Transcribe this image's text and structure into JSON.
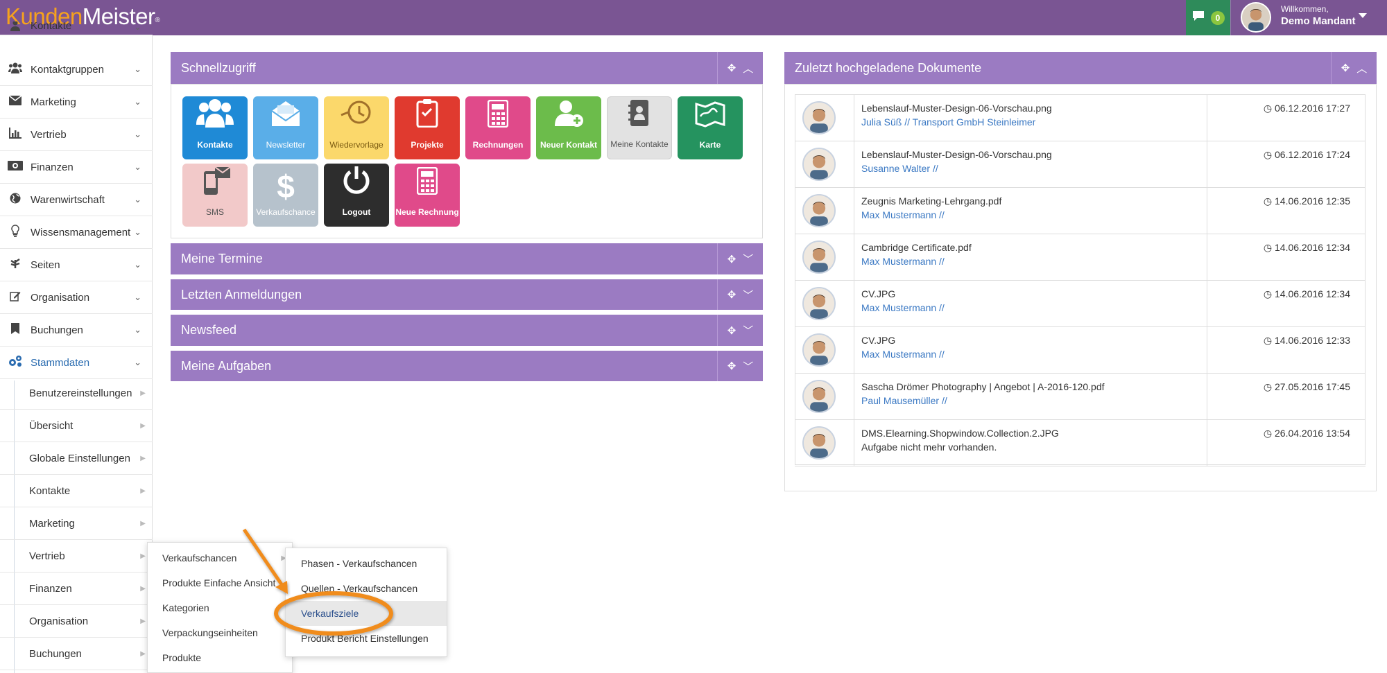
{
  "header": {
    "logo_part1": "Kunden",
    "logo_part2": "Meister",
    "logo_reg": "®",
    "message_count": "0",
    "welcome": "Willkommen,",
    "user_name": "Demo Mandant"
  },
  "sidebar": {
    "items": [
      {
        "label": "Kontakte",
        "icon": "person-icon"
      },
      {
        "label": "Kontaktgruppen",
        "icon": "group-icon"
      },
      {
        "label": "Marketing",
        "icon": "envelope-icon"
      },
      {
        "label": "Vertrieb",
        "icon": "bar-chart-icon"
      },
      {
        "label": "Finanzen",
        "icon": "money-icon"
      },
      {
        "label": "Warenwirtschaft",
        "icon": "globe-icon"
      },
      {
        "label": "Wissensmanagement",
        "icon": "lightbulb-icon"
      },
      {
        "label": "Seiten",
        "icon": "leaf-icon"
      },
      {
        "label": "Organisation",
        "icon": "edit-icon"
      },
      {
        "label": "Buchungen",
        "icon": "bookmark-icon"
      },
      {
        "label": "Stammdaten",
        "icon": "cogs-icon"
      }
    ],
    "subitems": [
      "Benutzereinstellungen",
      "Übersicht",
      "Globale Einstellungen",
      "Kontakte",
      "Marketing",
      "Vertrieb",
      "Finanzen",
      "Organisation",
      "Buchungen"
    ]
  },
  "quickaccess": {
    "title": "Schnellzugriff",
    "tiles": [
      {
        "label": "Kontakte",
        "color": "#1f8ad6",
        "icon": "users-icon"
      },
      {
        "label": "Newsletter",
        "color": "#5aaee8",
        "icon": "mail-icon"
      },
      {
        "label": "Wiedervorlage",
        "color": "#fbd86b",
        "icon": "clock-icon"
      },
      {
        "label": "Projekte",
        "color": "#e03a2f",
        "icon": "clipboard-icon"
      },
      {
        "label": "Rechnungen",
        "color": "#e04a8a",
        "icon": "calculator-icon"
      },
      {
        "label": "Neuer Kontakt",
        "color": "#6cbc4b",
        "icon": "add-user-icon"
      },
      {
        "label": "Meine Kontakte",
        "color": "#e2e2e2",
        "icon": "contact-book-icon"
      },
      {
        "label": "Karte",
        "color": "#25935f",
        "icon": "map-icon"
      },
      {
        "label": "SMS",
        "color": "#f2c9c9",
        "icon": "phone-icon"
      },
      {
        "label": "Verkaufschance",
        "color": "#b6c2cc",
        "icon": "dollar-icon"
      },
      {
        "label": "Logout",
        "color": "#2d2d2d",
        "icon": "power-icon"
      },
      {
        "label": "Neue Rechnung",
        "color": "#e04a8a",
        "icon": "calculator-icon"
      }
    ]
  },
  "collapsed_panels": [
    "Meine Termine",
    "Letzten Anmeldungen",
    "Newsfeed",
    "Meine Aufgaben"
  ],
  "documents": {
    "title": "Zuletzt hochgeladene Dokumente",
    "rows": [
      {
        "file": "Lebenslauf-Muster-Design-06-Vorschau.png",
        "sub": "Julia Süß // Transport GmbH Steinleimer",
        "date": "06.12.2016 17:27"
      },
      {
        "file": "Lebenslauf-Muster-Design-06-Vorschau.png",
        "sub": "Susanne Walter //",
        "date": "06.12.2016 17:24"
      },
      {
        "file": "Zeugnis Marketing-Lehrgang.pdf",
        "sub": "Max Mustermann //",
        "date": "14.06.2016 12:35"
      },
      {
        "file": "Cambridge Certificate.pdf",
        "sub": "Max Mustermann //",
        "date": "14.06.2016 12:34"
      },
      {
        "file": "CV.JPG",
        "sub": "Max Mustermann //",
        "date": "14.06.2016 12:34"
      },
      {
        "file": "CV.JPG",
        "sub": "Max Mustermann //",
        "date": "14.06.2016 12:33"
      },
      {
        "file": "Sascha Drömer Photography | Angebot | A-2016-120.pdf",
        "sub": "Paul Mausemüller //",
        "date": "27.05.2016 17:45"
      },
      {
        "file": "DMS.Elearning.Shopwindow.Collection.2.JPG",
        "sub": "Aufgabe nicht mehr vorhanden.",
        "date": "26.04.2016 13:54"
      }
    ]
  },
  "vertrieb_menu": [
    "Verkaufschancen",
    "Produkte Einfache Ansicht",
    "Kategorien",
    "Verpackungseinheiten",
    "Produkte"
  ],
  "verkaufschancen_menu": [
    "Phasen - Verkaufschancen",
    "Quellen - Verkaufschancen",
    "Verkaufsziele",
    "Produkt Bericht Einstellungen"
  ],
  "colors": {
    "topbar": "#7a5593",
    "panel": "#9b7bc2",
    "accent": "#f08c1e",
    "link": "#3a78c3"
  }
}
